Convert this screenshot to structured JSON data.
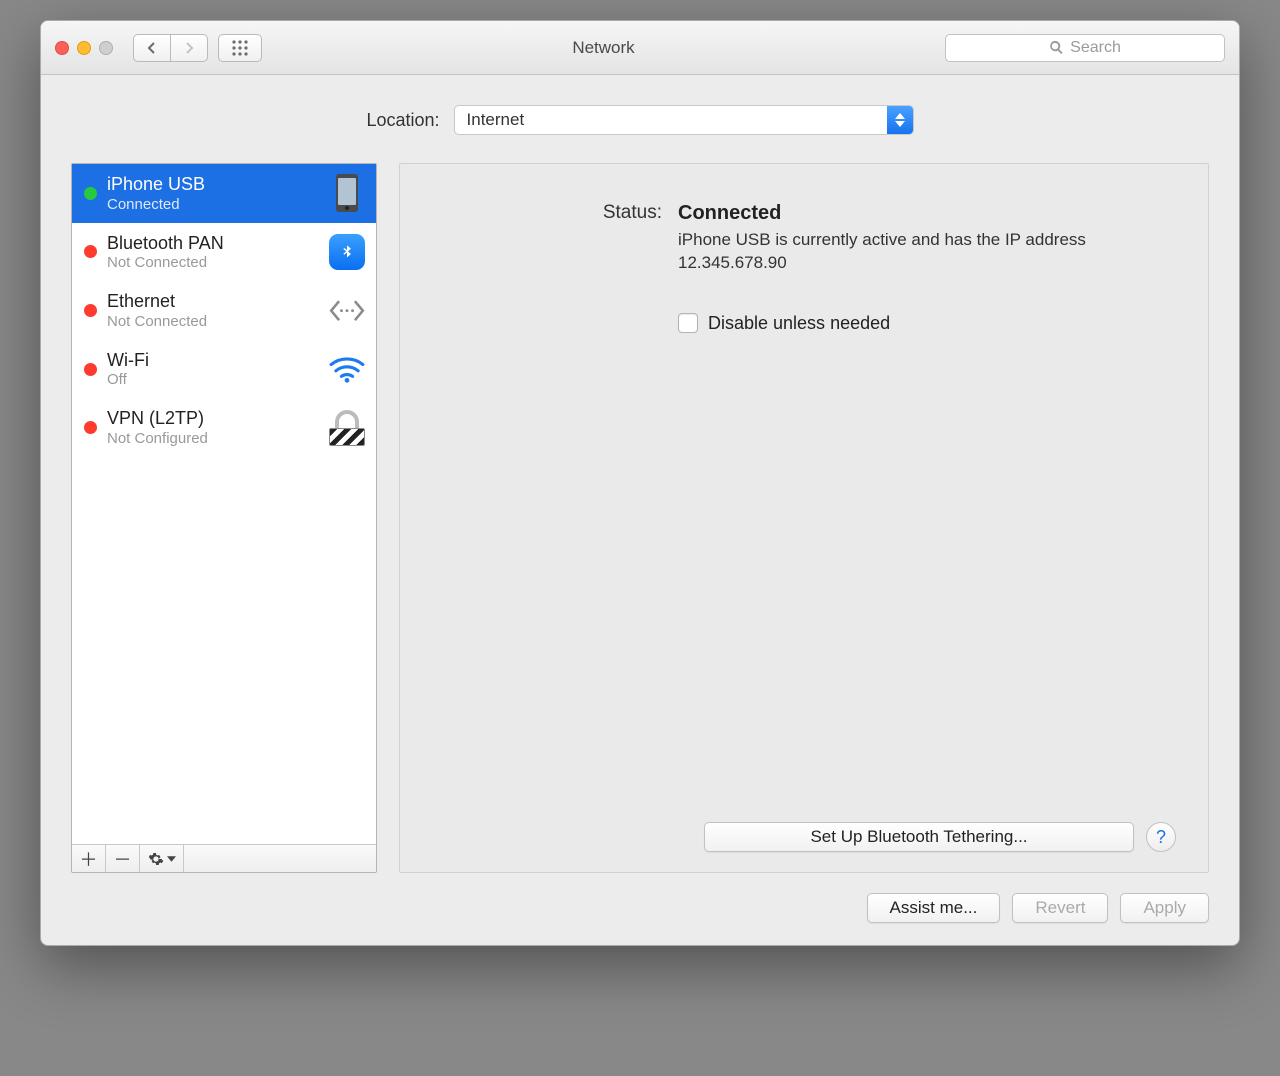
{
  "window": {
    "title": "Network"
  },
  "search": {
    "placeholder": "Search"
  },
  "location": {
    "label": "Location:",
    "value": "Internet"
  },
  "services": [
    {
      "name": "iPhone USB",
      "status_text": "Connected",
      "status": "green",
      "selected": true,
      "icon": "iphone"
    },
    {
      "name": "Bluetooth PAN",
      "status_text": "Not Connected",
      "status": "red",
      "selected": false,
      "icon": "bluetooth"
    },
    {
      "name": "Ethernet",
      "status_text": "Not Connected",
      "status": "red",
      "selected": false,
      "icon": "ethernet"
    },
    {
      "name": "Wi-Fi",
      "status_text": "Off",
      "status": "red",
      "selected": false,
      "icon": "wifi"
    },
    {
      "name": "VPN (L2TP)",
      "status_text": "Not Configured",
      "status": "red",
      "selected": false,
      "icon": "vpn"
    }
  ],
  "detail": {
    "status_label": "Status:",
    "status_value": "Connected",
    "description": "iPhone USB is currently active and has the IP address 12.345.678.90",
    "disable_checkbox_label": "Disable unless needed",
    "tether_button": "Set Up Bluetooth Tethering..."
  },
  "footer": {
    "assist": "Assist me...",
    "revert": "Revert",
    "apply": "Apply"
  }
}
